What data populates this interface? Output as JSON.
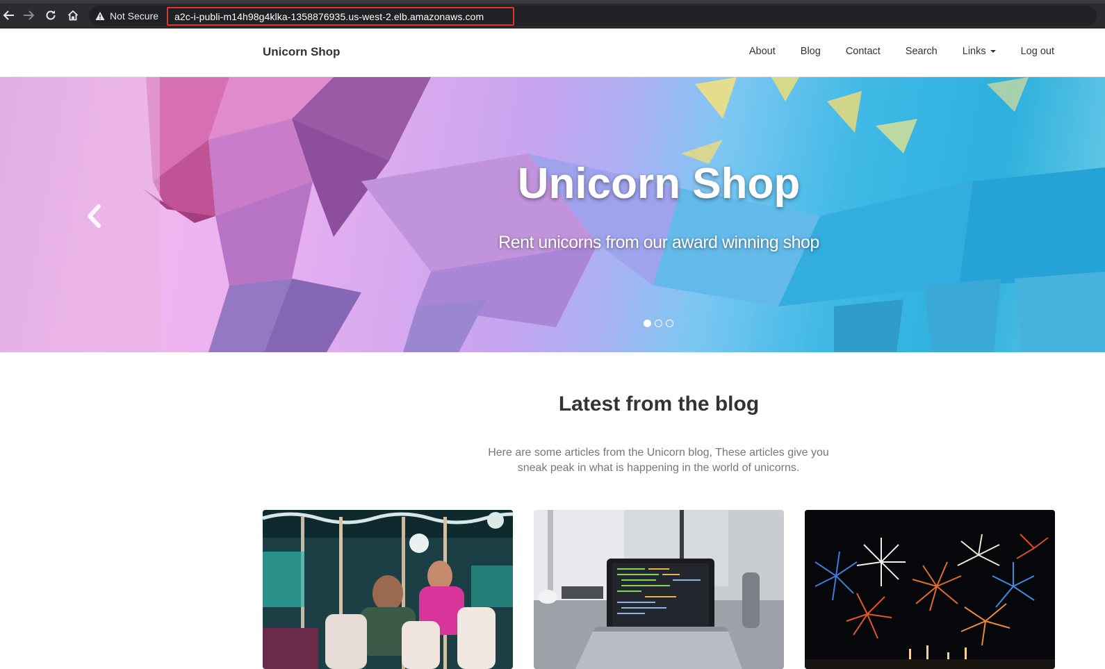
{
  "browser": {
    "security_label": "Not Secure",
    "url": "a2c-i-publi-m14h98g4klka-1358876935.us-west-2.elb.amazonaws.com",
    "icons": [
      "back-arrow-icon",
      "forward-arrow-icon",
      "reload-icon",
      "home-icon",
      "warning-icon"
    ]
  },
  "navbar": {
    "brand": "Unicorn Shop",
    "links": [
      {
        "label": "About"
      },
      {
        "label": "Blog"
      },
      {
        "label": "Contact"
      },
      {
        "label": "Search"
      },
      {
        "label": "Links",
        "has_dropdown": true
      },
      {
        "label": "Log out"
      }
    ]
  },
  "hero": {
    "title": "Unicorn Shop",
    "subtitle": "Rent unicorns from our award winning shop",
    "slide_count": 3,
    "active_slide": 1
  },
  "blog": {
    "heading": "Latest from the blog",
    "description": "Here are some articles from the Unicorn blog, These articles give you sneak peak in what is happening in the world of unicorns.",
    "cards": [
      {
        "image": "carousel-photo"
      },
      {
        "image": "laptop-code-photo"
      },
      {
        "image": "fireworks-photo"
      }
    ]
  },
  "colors": {
    "chrome_bg": "#2b2c2f",
    "url_highlight": "#e0362a",
    "text_dark": "#333333",
    "text_muted": "#777777"
  }
}
